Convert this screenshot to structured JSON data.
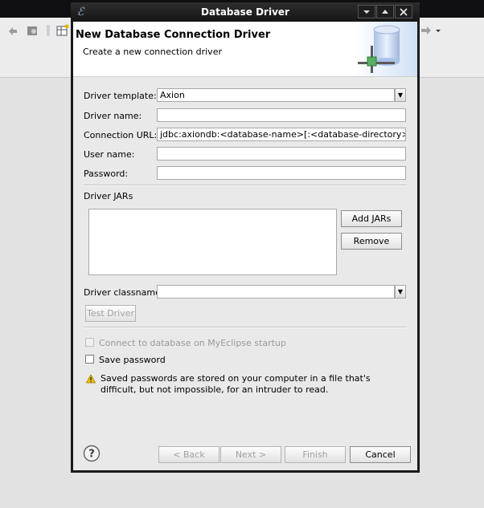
{
  "dialog": {
    "title": "Database Driver",
    "header": {
      "title": "New Database Connection Driver",
      "description": "Create a new connection driver"
    }
  },
  "form": {
    "driver_template": {
      "label": "Driver template:",
      "value": "Axion"
    },
    "driver_name": {
      "label": "Driver name:",
      "value": ""
    },
    "connection_url": {
      "label": "Connection URL:",
      "value": "jdbc:axiondb:<database-name>[:<database-directory>]"
    },
    "user_name": {
      "label": "User name:",
      "value": ""
    },
    "password": {
      "label": "Password:",
      "value": ""
    },
    "driver_jars": {
      "label": "Driver JARs",
      "add_label": "Add JARs",
      "remove_label": "Remove"
    },
    "driver_classname": {
      "label": "Driver classname:",
      "value": ""
    },
    "test_driver_label": "Test Driver",
    "connect_on_startup": {
      "label": "Connect to database on MyEclipse startup",
      "checked": false,
      "enabled": false
    },
    "save_password": {
      "label": "Save password",
      "checked": false
    },
    "warning": "Saved passwords are stored on your computer in a file that's difficult, but not impossible, for an intruder to read."
  },
  "buttons": {
    "back": "< Back",
    "next": "Next >",
    "finish": "Finish",
    "cancel": "Cancel"
  },
  "icons": {
    "title": "myeclipse-logo-icon",
    "header": "database-driver-icon",
    "warning": "warning-icon",
    "help": "help-icon"
  },
  "colors": {
    "titlebar": "#1a1a1a",
    "dialog_bg": "#e9e9e9",
    "warning_icon": "#f2c200"
  }
}
